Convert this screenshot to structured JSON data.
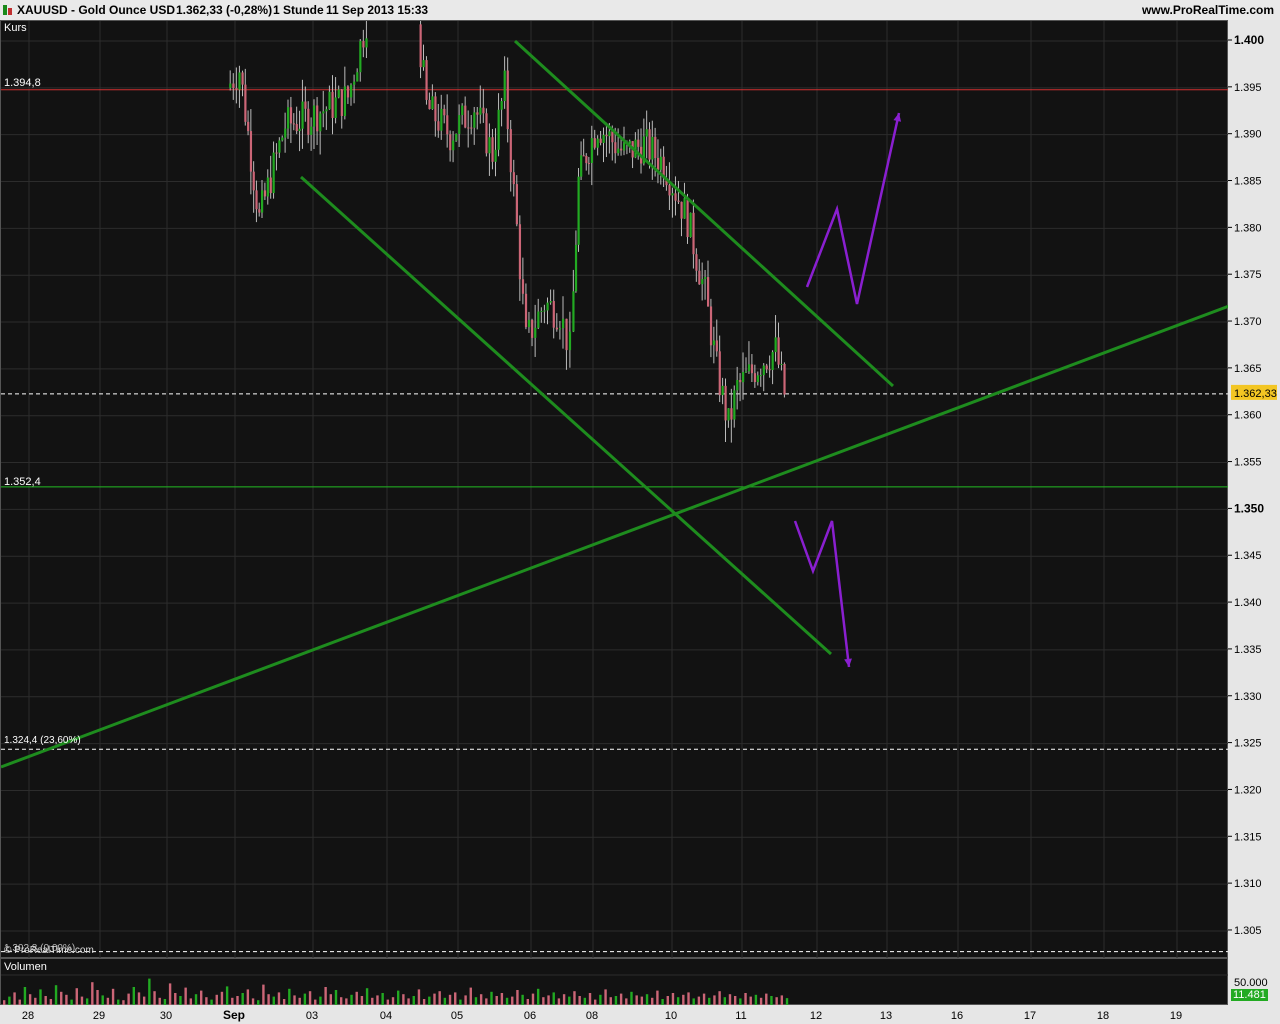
{
  "header": {
    "symbol": "XAUUSD - Gold Ounce USD",
    "last": "1.362,33 (-0,28%)",
    "period": "1 Stunde",
    "timestamp": "11 Sep 2013 15:33",
    "site": "www.ProRealTime.com"
  },
  "price_panel": {
    "label": "Kurs",
    "watermark": "© ProRealTime.com",
    "last_price_tag": "1.362,33",
    "levels": [
      {
        "label": "1.394,8",
        "value": 1394.8,
        "color": "#d03030",
        "style": "solid"
      },
      {
        "label": "1.352,4",
        "value": 1352.4,
        "color": "#22bb22",
        "style": "solid"
      },
      {
        "label": "1.324,4 (23,60%)",
        "value": 1324.4,
        "color": "#ffffff",
        "style": "dashed"
      },
      {
        "label": "1.302,8 (0,00%)",
        "value": 1302.8,
        "color": "#ffffff",
        "style": "dashed"
      }
    ],
    "y_ticks": [
      "1.400",
      "1.395",
      "1.390",
      "1.385",
      "1.380",
      "1.375",
      "1.370",
      "1.365",
      "1.360",
      "1.355",
      "1.350",
      "1.345",
      "1.340",
      "1.335",
      "1.330",
      "1.325",
      "1.320",
      "1.315",
      "1.310",
      "1.305"
    ]
  },
  "volume_panel": {
    "label": "Volumen",
    "ticks": [
      "50.000"
    ],
    "last_tag": "11.481"
  },
  "x_axis": {
    "labels": [
      "28",
      "29",
      "30",
      "Sep",
      "03",
      "04",
      "05",
      "06",
      "08",
      "10",
      "11",
      "12",
      "13",
      "16",
      "17",
      "18",
      "19"
    ]
  },
  "colors": {
    "up": "#22aa22",
    "down": "#cc6677",
    "trend": "#1e8c1e",
    "arrow": "#8a1fd0",
    "level_red": "#d03030",
    "tag": "#f3c623"
  },
  "chart_data": {
    "type": "candlestick",
    "title": "XAUUSD - Gold Ounce USD",
    "timeframe": "1 Stunde",
    "ylim": [
      1302,
      1401
    ],
    "last_price": 1362.33,
    "change_pct": -0.28,
    "close_path": [
      [
        "2013-08-30 22:00",
        1395
      ],
      [
        "2013-09-02 02:00",
        1397
      ],
      [
        "2013-09-02 08:00",
        1381
      ],
      [
        "2013-09-02 16:00",
        1391
      ],
      [
        "2013-09-03 00:00",
        1392
      ],
      [
        "2013-09-03 12:00",
        1394
      ],
      [
        "2013-09-03 20:00",
        1405
      ],
      [
        "2013-09-04 10:00",
        1405
      ],
      [
        "2013-09-04 14:00",
        1393
      ],
      [
        "2013-09-04 22:00",
        1390
      ],
      [
        "2013-09-05 06:00",
        1393
      ],
      [
        "2013-09-05 12:00",
        1388
      ],
      [
        "2013-09-05 16:00",
        1395
      ],
      [
        "2013-09-05 20:00",
        1380
      ],
      [
        "2013-09-05 23:00",
        1368
      ],
      [
        "2013-09-06 06:00",
        1372
      ],
      [
        "2013-09-06 12:00",
        1371
      ],
      [
        "2013-09-06 16:00",
        1367
      ],
      [
        "2013-09-06 19:00",
        1385
      ],
      [
        "2013-09-06 22:00",
        1388
      ],
      [
        "2013-09-09 02:00",
        1391
      ],
      [
        "2013-09-09 10:00",
        1388
      ],
      [
        "2013-09-09 16:00",
        1389
      ],
      [
        "2013-09-09 22:00",
        1387
      ],
      [
        "2013-09-10 06:00",
        1381
      ],
      [
        "2013-09-10 12:00",
        1373
      ],
      [
        "2013-09-10 16:00",
        1365
      ],
      [
        "2013-09-10 20:00",
        1359
      ],
      [
        "2013-09-10 23:00",
        1363
      ],
      [
        "2013-09-11 08:00",
        1366
      ],
      [
        "2013-09-11 12:00",
        1367
      ],
      [
        "2013-09-11 15:00",
        1362.33
      ]
    ],
    "volume": [
      8000,
      14000,
      21000,
      9000,
      30000,
      18000,
      12000,
      26000,
      15000,
      10000,
      33000,
      22000,
      17000,
      9000,
      28000,
      14000,
      11000,
      38000,
      25000,
      16000,
      12000,
      27000,
      9000,
      8000,
      19000,
      30000,
      21000,
      14000,
      44000,
      23000,
      12000,
      10000,
      36000,
      20000,
      15000,
      29000,
      11000,
      18000,
      24000,
      13000,
      9000,
      17000,
      22000,
      31000,
      12000,
      15000,
      20000,
      26000,
      11000,
      8000,
      34000,
      18000,
      14000,
      21000,
      10000,
      27000,
      16000,
      12000,
      19000,
      23000,
      9000,
      14000,
      30000,
      18000,
      25000,
      13000,
      11000,
      17000,
      22000,
      15000,
      28000,
      12000,
      16000,
      20000,
      9000,
      13000,
      24000,
      18000,
      11000,
      15000,
      26000,
      10000,
      14000,
      19000,
      23000,
      12000,
      17000,
      21000,
      9000,
      16000,
      29000,
      13000,
      18000,
      11000,
      22000,
      15000,
      20000,
      12000,
      14000,
      25000,
      17000,
      10000,
      19000,
      27000,
      13000,
      16000,
      21000,
      11000,
      18000,
      14000,
      23000,
      15000,
      12000,
      20000,
      9000,
      17000,
      26000,
      13000,
      15000,
      19000,
      11000,
      22000,
      16000,
      14000,
      18000,
      12000,
      24000,
      10000,
      15000,
      20000,
      13000,
      17000,
      21000,
      11000,
      14000,
      19000,
      12000,
      16000,
      23000,
      13000,
      18000,
      15000,
      11000,
      20000,
      14000,
      17000,
      12000,
      19000,
      15000,
      13000,
      16000,
      11481
    ],
    "trend_lines": [
      {
        "name": "upper channel",
        "from": [
          514,
          20
        ],
        "to": [
          892,
          365
        ]
      },
      {
        "name": "lower channel",
        "from": [
          300,
          156
        ],
        "to": [
          830,
          633
        ]
      },
      {
        "name": "rising support",
        "from": [
          0,
          746
        ],
        "to": [
          1228,
          285
        ]
      }
    ],
    "scenario_arrows": [
      {
        "points": [
          [
            806,
            266
          ],
          [
            836,
            188
          ],
          [
            856,
            283
          ],
          [
            898,
            92
          ]
        ]
      },
      {
        "points": [
          [
            794,
            500
          ],
          [
            812,
            550
          ],
          [
            831,
            500
          ],
          [
            848,
            646
          ]
        ]
      }
    ]
  }
}
